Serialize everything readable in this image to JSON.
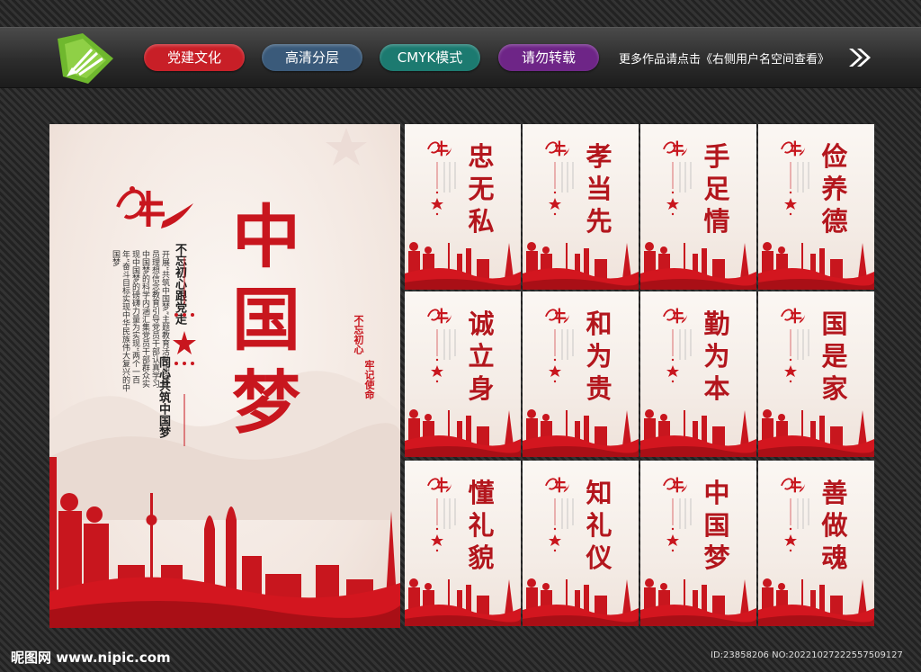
{
  "header": {
    "tags": [
      "党建文化",
      "高清分层",
      "CMYK模式",
      "请勿转载"
    ],
    "more_text": "更多作品请点击《右侧用户名空间查看》"
  },
  "main_poster": {
    "title": "中国梦",
    "slogan_1": "不忘初心跟党走",
    "slogan_2": "同心共筑中国梦",
    "stamp_1": "不忘初心",
    "stamp_2": "牢记使命",
    "body": "开展“共筑中国梦”主题教育活动加强党员理想信念教育引导党员干部认真学习中国梦的科学内涵汇集党员干部群众实现中国梦的磅礴力量为实现“两个一百年”奋斗目标实现中华民族伟大复兴的中国梦"
  },
  "posters": [
    "忠无私",
    "孝当先",
    "手足情",
    "俭养德",
    "诚立身",
    "和为贵",
    "勤为本",
    "国是家",
    "懂礼貌",
    "知礼仪",
    "中国梦",
    "善做魂"
  ],
  "footer": {
    "site": "昵图网 www.nipic.com",
    "id_text": "ID:23858206 NO:20221027222557509127"
  },
  "colors": {
    "party_red": "#c8161e",
    "tag_red": "#c81f27",
    "tag_blue": "#3a5a7a",
    "tag_teal": "#1c7a70",
    "tag_purple": "#6e2587"
  }
}
